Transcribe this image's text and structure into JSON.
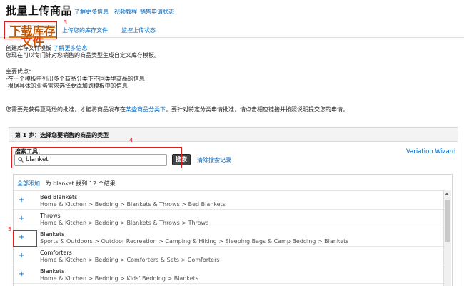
{
  "header": {
    "title": "批量上传商品",
    "links": [
      "了解更多信息",
      "视频教程",
      "销售申请状态"
    ]
  },
  "tabs": [
    {
      "label": "下载库存文件"
    },
    {
      "label": "上传您的库存文件"
    },
    {
      "label": "监控上传状态"
    }
  ],
  "annotations": [
    "3",
    "4",
    "5"
  ],
  "intro": {
    "line1_prefix": "创建库存文件模板",
    "line1_link": "了解更多信息",
    "line2": "您现在可以专门针对您销售的商品类型生成自定义库存模板。",
    "benefits_title": "主要优点：",
    "benefit1": "-在一个模板中列出多个商品分类下不同类型商品的信息",
    "benefit2": "-根据具体的业务需求选择要添加到模板中的信息",
    "approval_prefix": "您需要先获得亚马逊的批准，才能将商品发布在",
    "approval_link": "某些商品分类下",
    "approval_suffix": "。要针对特定分类申请批准，请点击相应链接并按照说明提交您的申请。"
  },
  "step": {
    "title": "第 1 步：选择您要销售的商品的类型",
    "variation_wizard": "Variation Wizard"
  },
  "search": {
    "label": "搜索工具：",
    "value": "blanket",
    "button": "搜索",
    "clear": "清除搜索记录"
  },
  "results": {
    "add_all": "全部添加",
    "summary": "为 blanket 找到 12 个结果",
    "items": [
      {
        "title": "Bed Blankets",
        "path": "Home & Kitchen > Bedding > Blankets & Throws > Bed Blankets"
      },
      {
        "title": "Throws",
        "path": "Home & Kitchen > Bedding > Blankets & Throws > Throws"
      },
      {
        "title": "Blankets",
        "path": "Sports & Outdoors > Outdoor Recreation > Camping & Hiking > Sleeping Bags & Camp Bedding > Blankets"
      },
      {
        "title": "Comforters",
        "path": "Home & Kitchen > Bedding > Comforters & Sets > Comforters"
      },
      {
        "title": "Blankets",
        "path": "Home & Kitchen > Bedding > Kids' Bedding > Blankets"
      }
    ]
  },
  "colors": {
    "link": "#0066c0",
    "annotation": "#e02020",
    "tab_accent": "#e47911"
  }
}
